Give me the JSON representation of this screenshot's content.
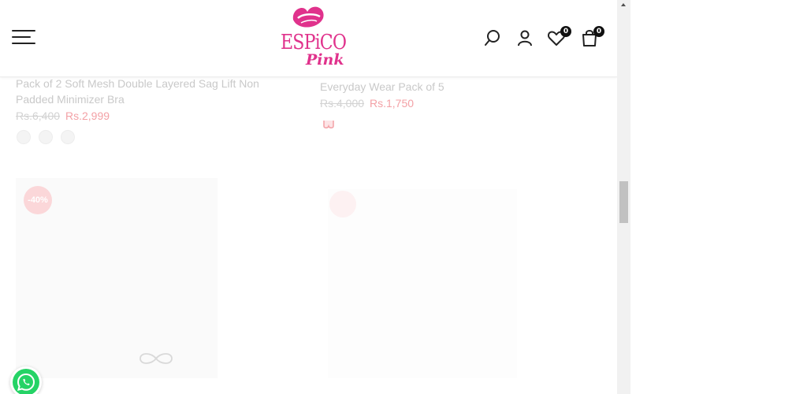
{
  "brand": {
    "name": "ESPiCO",
    "sub": "Pink",
    "color": "#e0328c"
  },
  "header": {
    "wishlist_count": "0",
    "cart_count": "0"
  },
  "products": [
    {
      "title_line1": "Pack of 2 Soft Mesh Double Layered Sag Lift Non",
      "title_line2": "Padded Minimizer Bra",
      "price_old": "Rs.6,400",
      "price_new": "Rs.2,999"
    },
    {
      "title_line1": "Everyday Wear Pack of 5",
      "price_old": "Rs.4,000",
      "price_new": "Rs.1,750"
    }
  ],
  "next_row": {
    "discount_badge": "-40%"
  },
  "icons": [
    "menu-icon",
    "search-icon",
    "user-icon",
    "heart-icon",
    "shopping-bag-icon",
    "whatsapp-icon",
    "bra-icon",
    "loading-infinity-icon"
  ]
}
